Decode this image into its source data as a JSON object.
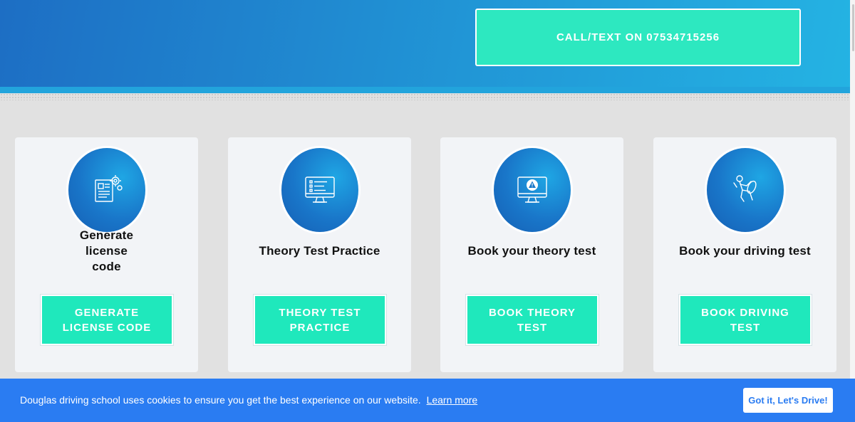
{
  "header": {
    "call_button_label": "CALL/TEXT ON 07534715256",
    "gradient_start": "#1d6ec4",
    "gradient_end": "#24b3e3"
  },
  "cards": [
    {
      "icon": "license-document-gear-icon",
      "title": "Generate license code",
      "button_label": "GENERATE LICENSE CODE"
    },
    {
      "icon": "computer-checklist-icon",
      "title": "Theory Test Practice",
      "button_label": "THEORY TEST PRACTICE"
    },
    {
      "icon": "computer-warning-icon",
      "title": "Book your theory test",
      "button_label": "BOOK THEORY TEST"
    },
    {
      "icon": "driver-steering-wheel-icon",
      "title": "Book your driving test",
      "button_label": "BOOK DRIVING TEST"
    }
  ],
  "cookie_banner": {
    "message": "Douglas driving school uses cookies to ensure you get the best experience on our website.",
    "link_label": "Learn more",
    "accept_label": "Got it, Let's Drive!",
    "background": "#2a7cf2"
  },
  "colors": {
    "accent": "#1fe8bc",
    "card_background": "#f2f4f7",
    "page_background": "#e1e1e1"
  }
}
